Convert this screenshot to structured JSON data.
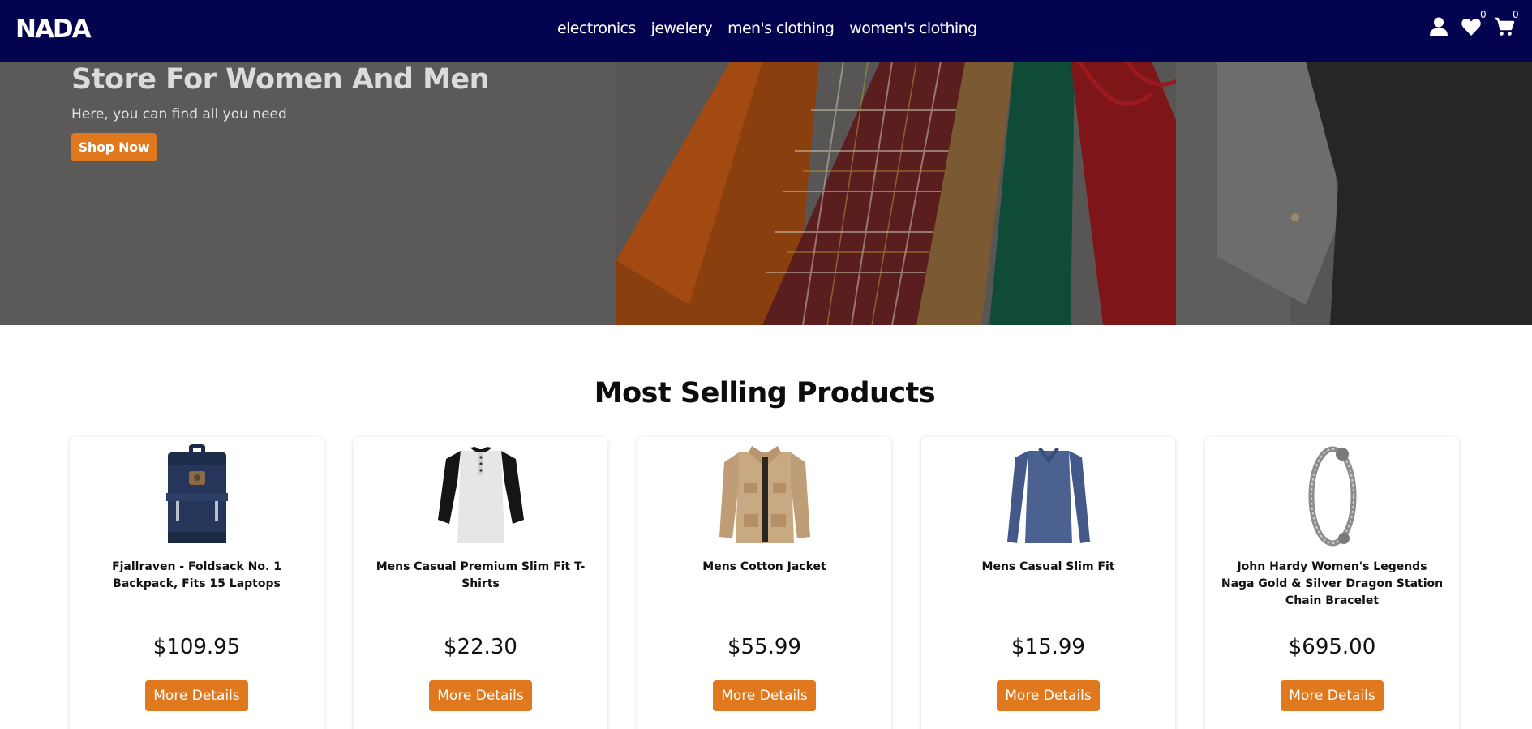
{
  "navbar": {
    "logo": "NADA",
    "links": [
      "electronics",
      "jewelery",
      "men's clothing",
      "women's clothing"
    ],
    "icons": {
      "account": "user-icon",
      "wishlist": "heart-icon",
      "cart": "cart-icon"
    },
    "wishlist_count": "0",
    "cart_count": "0"
  },
  "hero": {
    "title": "Store For Women And Men",
    "subtitle": "Here, you can find all you need",
    "button_label": "Shop Now"
  },
  "section": {
    "title": "Most Selling Products"
  },
  "products": [
    {
      "title": "Fjallraven - Foldsack No. 1 Backpack, Fits 15 Laptops",
      "price": "$109.95",
      "button_label": "More Details",
      "image": "backpack"
    },
    {
      "title": "Mens Casual Premium Slim Fit T-Shirts",
      "price": "$22.30",
      "button_label": "More Details",
      "image": "raglan-tshirt"
    },
    {
      "title": "Mens Cotton Jacket",
      "price": "$55.99",
      "button_label": "More Details",
      "image": "khaki-jacket"
    },
    {
      "title": "Mens Casual Slim Fit",
      "price": "$15.99",
      "button_label": "More Details",
      "image": "blue-longsleeve"
    },
    {
      "title": "John Hardy Women's Legends Naga Gold & Silver Dragon Station Chain Bracelet",
      "price": "$695.00",
      "button_label": "More Details",
      "image": "dragon-bracelet"
    }
  ],
  "colors": {
    "navbar": "#04034f",
    "accent": "#e0781e"
  }
}
